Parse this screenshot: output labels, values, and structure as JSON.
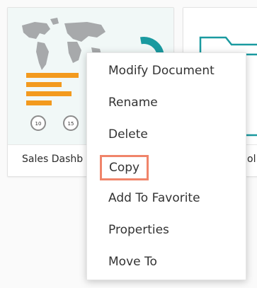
{
  "cards": [
    {
      "name": "Sales Dashb"
    },
    {
      "name": "ol"
    }
  ],
  "thumbnail": {
    "kpi_values": [
      "10",
      "15"
    ],
    "accent_teal": "#1a9aa0",
    "accent_orange": "#f39a1e"
  },
  "context_menu": {
    "items": [
      {
        "label": "Modify Document"
      },
      {
        "label": "Rename"
      },
      {
        "label": "Delete"
      },
      {
        "label": "Copy",
        "highlighted": true
      },
      {
        "label": "Add To Favorite"
      },
      {
        "label": "Properties"
      },
      {
        "label": "Move To"
      }
    ],
    "highlight_color": "#f0846a"
  }
}
